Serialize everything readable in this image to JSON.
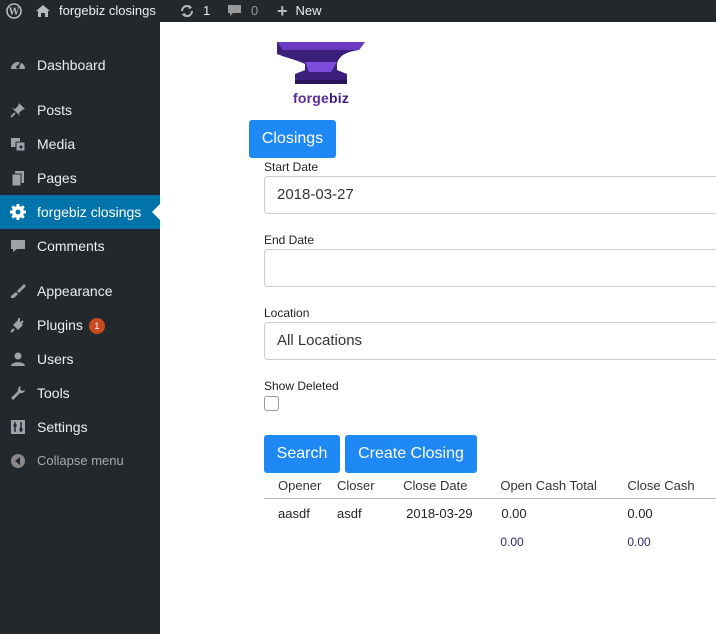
{
  "adminbar": {
    "site_name": "forgebiz closings",
    "updates_count": "1",
    "comments_count": "0",
    "new_label": "New"
  },
  "sidebar": {
    "items": [
      {
        "label": "Dashboard",
        "icon": "dashboard-icon"
      },
      {
        "label": "Posts",
        "icon": "pin-icon"
      },
      {
        "label": "Media",
        "icon": "media-icon"
      },
      {
        "label": "Pages",
        "icon": "pages-icon"
      },
      {
        "label": "forgebiz closings",
        "icon": "gear-icon"
      },
      {
        "label": "Comments",
        "icon": "comment-icon"
      },
      {
        "label": "Appearance",
        "icon": "brush-icon"
      },
      {
        "label": "Plugins",
        "icon": "plug-icon",
        "badge": "1"
      },
      {
        "label": "Users",
        "icon": "user-icon"
      },
      {
        "label": "Tools",
        "icon": "wrench-icon"
      },
      {
        "label": "Settings",
        "icon": "sliders-icon"
      },
      {
        "label": "Collapse menu",
        "icon": "collapse-icon"
      }
    ],
    "current_index": 4
  },
  "logo": {
    "text_forge": "forge",
    "text_biz": "biz"
  },
  "page": {
    "title_button": "Closings",
    "start_date_label": "Start Date",
    "start_date_value": "2018-03-27",
    "end_date_label": "End Date",
    "end_date_value": "",
    "location_label": "Location",
    "location_value": "All Locations",
    "show_deleted_label": "Show Deleted",
    "search_button": "Search",
    "create_button": "Create Closing"
  },
  "table": {
    "headers": [
      "Opener",
      "Closer",
      "Close Date",
      "Open Cash Total",
      "Close Cash"
    ],
    "rows": [
      [
        "aasdf",
        "asdf",
        "2018-03-29",
        "0.00",
        "0.00"
      ]
    ],
    "totals": [
      "",
      "",
      "",
      "0.00",
      "0.00"
    ]
  },
  "colors": {
    "adminbar_bg": "#23282d",
    "sidebar_active": "#0073aa",
    "button_blue": "#1e88f5",
    "badge": "#ca4a1f",
    "logo_purple": "#5b2a9e"
  }
}
